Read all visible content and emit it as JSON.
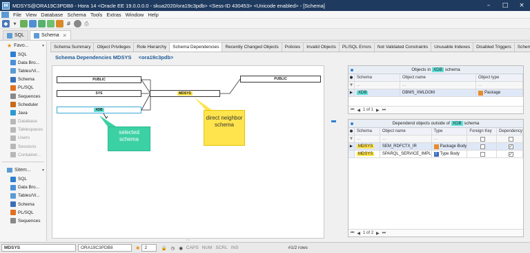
{
  "window": {
    "title": "MDSYS@ORA19C3PDB8 - Hora 14   <Oracle EE 19.0.0.0.0 - skua2020/ora19c3pdb>   <Sess-ID 430453>   <Unicode enabled> - [Schema]",
    "app_icon": "H"
  },
  "menu": [
    "File",
    "View",
    "Database",
    "Schema",
    "Tools",
    "Extras",
    "Window",
    "Help"
  ],
  "doc_tabs": [
    {
      "label": "SQL",
      "active": false
    },
    {
      "label": "Schema",
      "active": true
    }
  ],
  "sidebar": {
    "favorites_title": "Favo...",
    "favorites": [
      {
        "label": "SQL",
        "icon": "sql-icon",
        "color": "#2f7fd0",
        "dim": false
      },
      {
        "label": "Data Bro...",
        "icon": "data-browser-icon",
        "color": "#4a8fd8",
        "dim": false
      },
      {
        "label": "Tables/Vi...",
        "icon": "tables-icon",
        "color": "#5b9bd5",
        "dim": false
      },
      {
        "label": "Schema",
        "icon": "schema-icon",
        "color": "#3b6fb6",
        "dim": false
      },
      {
        "label": "PL/SQL",
        "icon": "plsql-icon",
        "color": "#e07020",
        "dim": false
      },
      {
        "label": "Sequences",
        "icon": "sequences-icon",
        "color": "#888888",
        "dim": false
      },
      {
        "label": "Scheduler",
        "icon": "scheduler-icon",
        "color": "#c86a1a",
        "dim": false
      },
      {
        "label": "Java",
        "icon": "java-icon",
        "color": "#2a9ad0",
        "dim": false
      },
      {
        "label": "Database",
        "icon": "database-icon",
        "color": "#b8b8b8",
        "dim": true
      },
      {
        "label": "Tablespaces",
        "icon": "tablespaces-icon",
        "color": "#b8b8b8",
        "dim": true
      },
      {
        "label": "Users",
        "icon": "users-icon",
        "color": "#b8b8b8",
        "dim": true
      },
      {
        "label": "Sessions",
        "icon": "sessions-icon",
        "color": "#b8b8b8",
        "dim": true
      },
      {
        "label": "Container...",
        "icon": "container-icon",
        "color": "#b8b8b8",
        "dim": true
      }
    ],
    "sitemap_title": "Sitem...",
    "sitemap": [
      {
        "label": "SQL",
        "icon": "sql-icon",
        "color": "#2f7fd0"
      },
      {
        "label": "Data Bro...",
        "icon": "data-browser-icon",
        "color": "#4a8fd8"
      },
      {
        "label": "Tables/Vi...",
        "icon": "tables-icon",
        "color": "#5b9bd5"
      },
      {
        "label": "Schema",
        "icon": "schema-icon",
        "color": "#3b6fb6"
      },
      {
        "label": "PL/SQL",
        "icon": "plsql-icon",
        "color": "#e07020"
      },
      {
        "label": "Sequences",
        "icon": "sequences-icon",
        "color": "#888888"
      }
    ]
  },
  "subtabs": [
    {
      "label": "Schema Summary",
      "active": false
    },
    {
      "label": "Object Privileges",
      "active": false
    },
    {
      "label": "Role Hierarchy",
      "active": false
    },
    {
      "label": "Schema Dependencies",
      "active": true
    },
    {
      "label": "Recently Changed Objects",
      "active": false
    },
    {
      "label": "Policies",
      "active": false
    },
    {
      "label": "Invalid Objects",
      "active": false
    },
    {
      "label": "PL/SQL Errors",
      "active": false
    },
    {
      "label": "Not Validated Constraints",
      "active": false
    },
    {
      "label": "Unusable Indexes",
      "active": false
    },
    {
      "label": "Disabled Triggers",
      "active": false
    },
    {
      "label": "Schema Triggers",
      "active": false
    },
    {
      "label": "Recy",
      "active": false
    }
  ],
  "main": {
    "title": "Schema Dependencies MDSYS",
    "title_suffix": "<ora19c3pdb>"
  },
  "diagram": {
    "nodes": {
      "public_left": "PUBLIC",
      "sys": "SYS",
      "xdb": "XDB",
      "mdsys": "MDSYS",
      "public_right": "PUBLIC"
    },
    "callout_green": "selected schema",
    "callout_yellow": "direct neighbor schema",
    "colors": {
      "selected": "#5fe0d7",
      "neighbor": "#ffe44d",
      "callout_green": "#3cd1a4"
    }
  },
  "objects_panel": {
    "title_prefix": "Objects in",
    "title_schema": "XDB",
    "title_suffix": "schema",
    "columns": [
      "Schema",
      "Object name",
      "Object type"
    ],
    "filter": [
      "...",
      "...",
      "..."
    ],
    "rows": [
      {
        "schema": "XDB",
        "object_name": "DBMS_XMLDOM",
        "object_type": "Package"
      }
    ],
    "pager": "1 of 1"
  },
  "dependents_panel": {
    "title_prefix": "Dependend objects outside of",
    "title_schema": "XDB",
    "title_suffix": "schema",
    "columns": [
      "Schema",
      "Object name",
      "Type",
      "Foreign Key",
      "Dependency"
    ],
    "rows": [
      {
        "schema": "MDSYS",
        "object_name": "SEM_RDFCTX_IR",
        "type": "Package Body",
        "foreign_key": false,
        "dependency": true
      },
      {
        "schema": "MDSYS",
        "object_name": "SPARQL_SERVICE_IMPL_T",
        "type": "Type Body",
        "foreign_key": false,
        "dependency": true
      }
    ],
    "pager": "1 of 2"
  },
  "statusbar": {
    "schema": "MDSYS",
    "database": "ORA19C3PDB8",
    "number": "2",
    "caps": "CAPS",
    "num": "NUM",
    "scrl": "SCRL",
    "ins": "INS",
    "rows": "#1/2 rows"
  }
}
